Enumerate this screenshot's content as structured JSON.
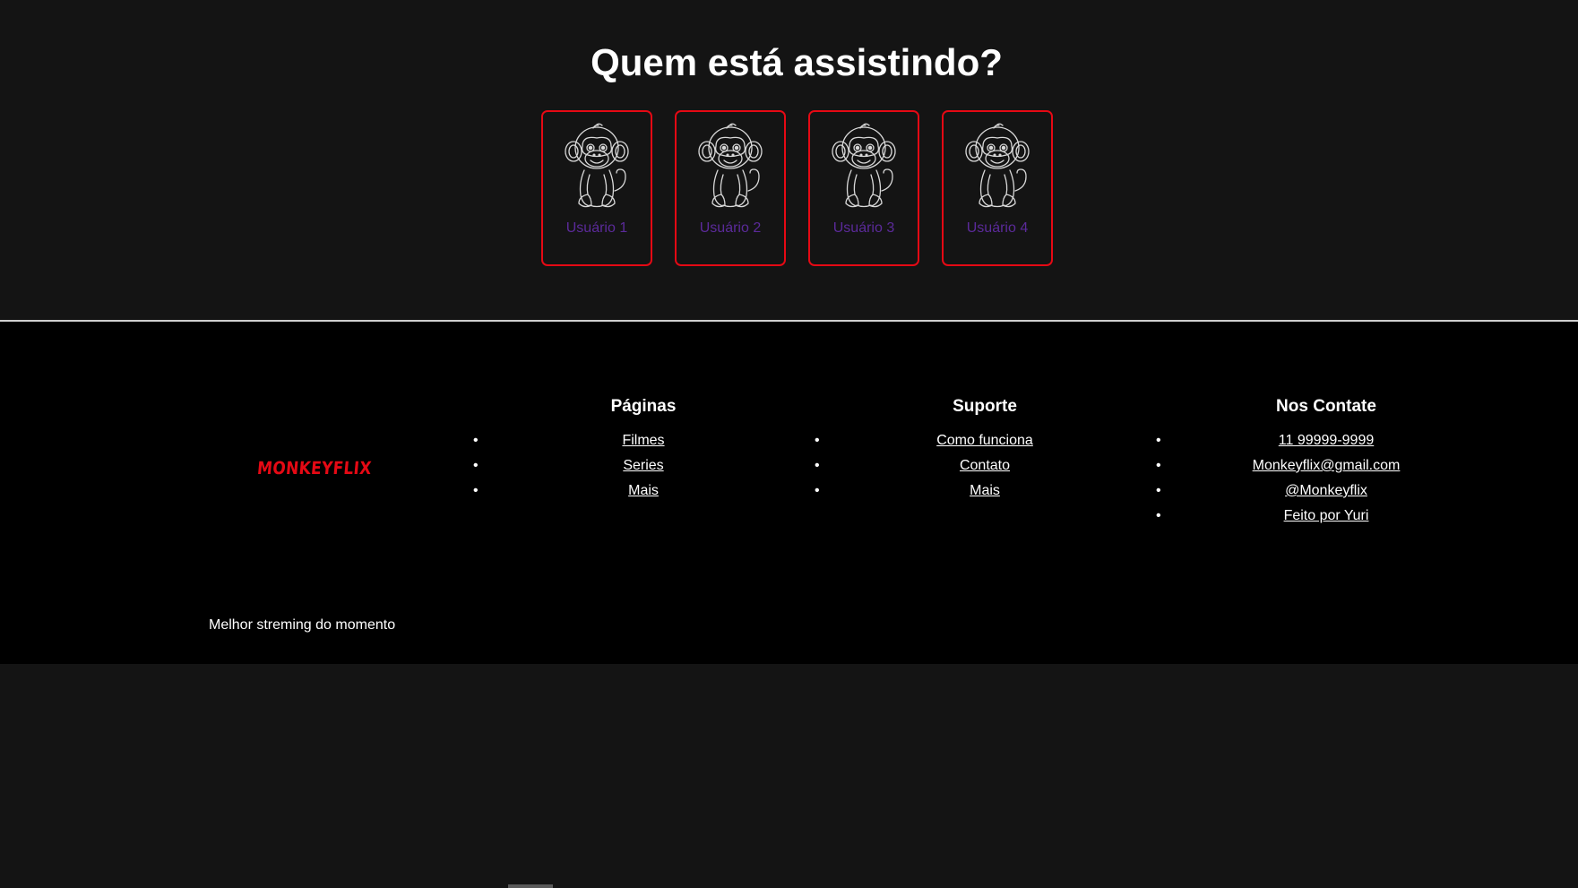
{
  "profiles": {
    "title": "Quem está assistindo?",
    "users": [
      {
        "label": "Usuário 1"
      },
      {
        "label": "Usuário 2"
      },
      {
        "label": "Usuário 3"
      },
      {
        "label": "Usuário 4"
      }
    ],
    "avatar_icon": "monkey-icon"
  },
  "footer": {
    "logo": "MONKEYFLIX",
    "tagline": "Melhor streming do momento",
    "paginas": {
      "title": "Páginas",
      "links": [
        "Filmes",
        "Series",
        "Mais"
      ]
    },
    "suporte": {
      "title": "Suporte",
      "links": [
        "Como funciona",
        "Contato",
        "Mais"
      ]
    },
    "contato": {
      "title": "Nos Contate",
      "links": [
        "11 99999-9999",
        "Monkeyflix@gmail.com",
        "@Monkeyflix",
        "Feito por Yuri"
      ]
    }
  },
  "colors": {
    "background": "#141414",
    "footer_background": "#000000",
    "accent": "#e50914",
    "user_label": "#5b2a9a"
  }
}
